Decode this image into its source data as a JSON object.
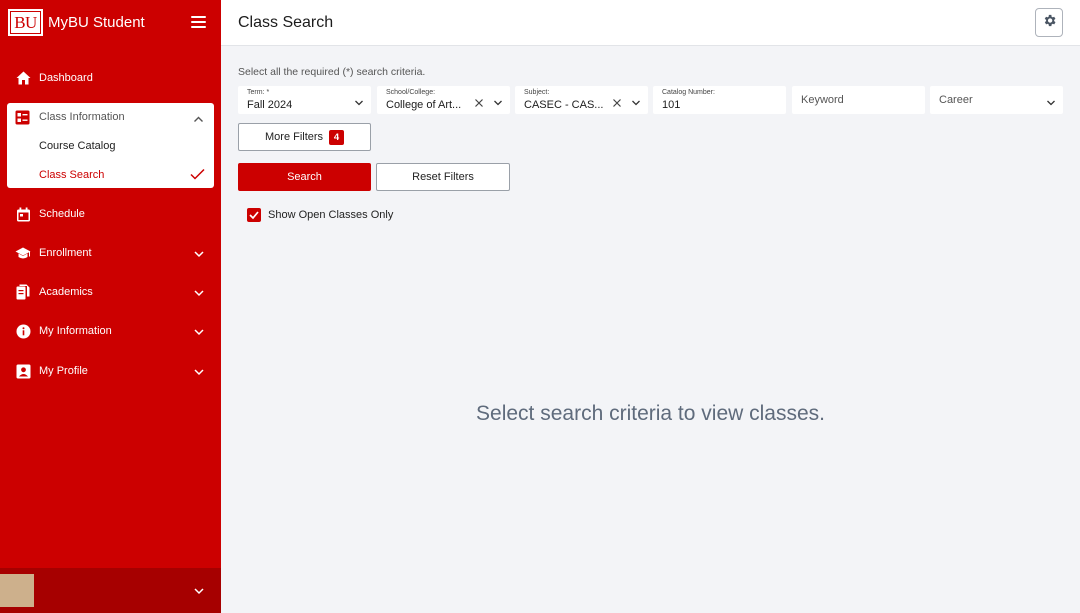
{
  "app": {
    "logo_text": "BU",
    "name": "MyBU Student"
  },
  "sidebar": {
    "items": [
      {
        "label": "Dashboard",
        "icon": "home-icon"
      },
      {
        "label": "Class Information",
        "icon": "class-list-icon",
        "expanded": true,
        "children": [
          {
            "label": "Course Catalog",
            "active": false
          },
          {
            "label": "Class Search",
            "active": true
          }
        ]
      },
      {
        "label": "Schedule",
        "icon": "calendar-icon"
      },
      {
        "label": "Enrollment",
        "icon": "graduation-cap-icon"
      },
      {
        "label": "Academics",
        "icon": "documents-icon"
      },
      {
        "label": "My Information",
        "icon": "info-icon"
      },
      {
        "label": "My Profile",
        "icon": "profile-icon"
      }
    ]
  },
  "header": {
    "title": "Class Search"
  },
  "search": {
    "instructions": "Select all the required (*) search criteria.",
    "term": {
      "label": "Term: *",
      "value": "Fall 2024"
    },
    "school": {
      "label": "School/College:",
      "value": "College of Art..."
    },
    "subject": {
      "label": "Subject:",
      "value": "CASEC - CAS..."
    },
    "catalog": {
      "label": "Catalog Number:",
      "value": "101"
    },
    "keyword": {
      "placeholder": "Keyword"
    },
    "career": {
      "placeholder": "Career"
    },
    "more_filters_label": "More Filters",
    "more_filters_count": "4",
    "search_label": "Search",
    "reset_label": "Reset Filters",
    "open_only_label": "Show Open Classes Only",
    "open_only_checked": true
  },
  "results": {
    "empty_message": "Select search criteria to view classes."
  },
  "colors": {
    "brand": "#cc0000",
    "background": "#f3f4f7",
    "text_muted": "#5f6b7c"
  }
}
